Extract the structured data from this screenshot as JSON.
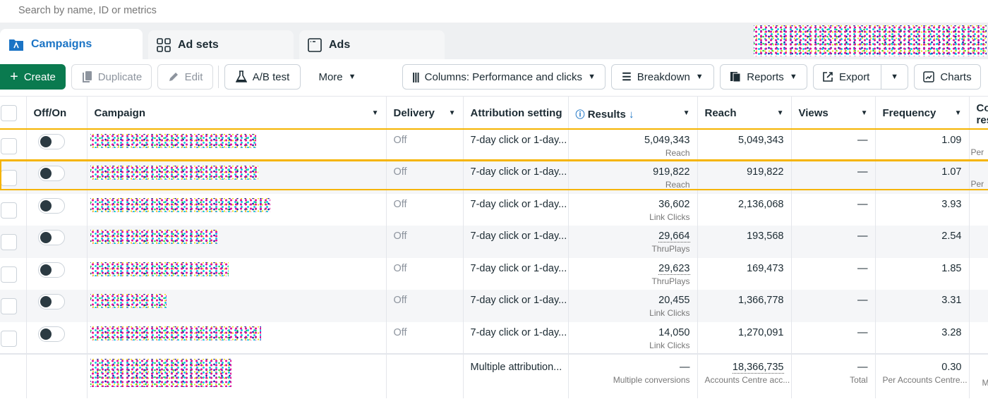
{
  "search": {
    "placeholder": "Search by name, ID or metrics"
  },
  "tabs": [
    {
      "label": "Campaigns",
      "icon": "campaign-folder-icon",
      "active": true
    },
    {
      "label": "Ad sets",
      "icon": "grid-icon"
    },
    {
      "label": "Ads",
      "icon": "window-icon"
    }
  ],
  "toolbar": {
    "create": "Create",
    "duplicate": "Duplicate",
    "edit": "Edit",
    "ab_test": "A/B test",
    "more": "More",
    "columns": "Columns: Performance and clicks",
    "breakdown": "Breakdown",
    "reports": "Reports",
    "export": "Export",
    "charts": "Charts"
  },
  "colors": {
    "accent": "#1b74c5",
    "create": "#0a7a4f",
    "highlight": "#f5b400"
  },
  "table": {
    "headers": {
      "toggle": "Off/On",
      "campaign": "Campaign",
      "delivery": "Delivery",
      "attribution": "Attribution setting",
      "results": "Results",
      "reach": "Reach",
      "views": "Views",
      "frequency": "Frequency",
      "next": "Co res"
    },
    "rows": [
      {
        "delivery": "Off",
        "attribution": "7-day click or 1-day...",
        "results": "5,049,343",
        "results_type": "Reach",
        "reach": "5,049,343",
        "views": "—",
        "frequency": "1.09",
        "next": "Per"
      },
      {
        "delivery": "Off",
        "attribution": "7-day click or 1-day...",
        "results": "919,822",
        "results_type": "Reach",
        "reach": "919,822",
        "views": "—",
        "frequency": "1.07",
        "next": "Per"
      },
      {
        "delivery": "Off",
        "attribution": "7-day click or 1-day...",
        "results": "36,602",
        "results_type": "Link Clicks",
        "reach": "2,136,068",
        "views": "—",
        "frequency": "3.93",
        "next": ""
      },
      {
        "delivery": "Off",
        "attribution": "7-day click or 1-day...",
        "results": "29,664",
        "results_type": "ThruPlays",
        "reach": "193,568",
        "views": "—",
        "frequency": "2.54",
        "next": ""
      },
      {
        "delivery": "Off",
        "attribution": "7-day click or 1-day...",
        "results": "29,623",
        "results_type": "ThruPlays",
        "reach": "169,473",
        "views": "—",
        "frequency": "1.85",
        "next": ""
      },
      {
        "delivery": "Off",
        "attribution": "7-day click or 1-day...",
        "results": "20,455",
        "results_type": "Link Clicks",
        "reach": "1,366,778",
        "views": "—",
        "frequency": "3.31",
        "next": ""
      },
      {
        "delivery": "Off",
        "attribution": "7-day click or 1-day...",
        "results": "14,050",
        "results_type": "Link Clicks",
        "reach": "1,270,091",
        "views": "—",
        "frequency": "3.28",
        "next": ""
      }
    ],
    "footer": {
      "attribution": "Multiple attribution...",
      "results": "—",
      "results_sub": "Multiple conversions",
      "reach": "18,366,735",
      "reach_sub": "Accounts Centre acc...",
      "views": "—",
      "views_sub": "Total",
      "frequency": "0.30",
      "frequency_sub": "Per Accounts Centre...",
      "next": "M"
    }
  }
}
